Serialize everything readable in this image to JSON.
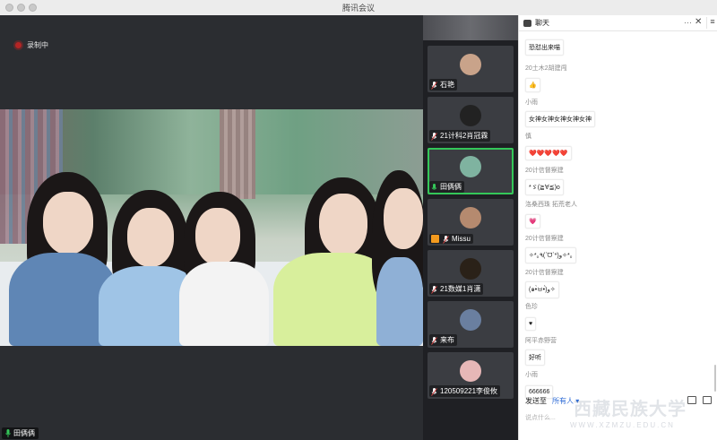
{
  "window": {
    "title": "腾讯会议"
  },
  "recording": {
    "label": "录制中"
  },
  "main_speaker": {
    "name": "田俩俩"
  },
  "participants": [
    {
      "name": "石艳",
      "avatar_color": "#c9a38a"
    },
    {
      "name": "21计科2肖冠霖",
      "avatar_color": "#222222"
    },
    {
      "name": "田俩俩",
      "avatar_color": "#7fb3a0",
      "active": true
    },
    {
      "name": "Missu",
      "avatar_color": "#b58a6f",
      "host": true
    },
    {
      "name": "21数媒1肖潇",
      "avatar_color": "#2a2118"
    },
    {
      "name": "来布",
      "avatar_color": "#6a7fa0"
    },
    {
      "name": "120509221李俊攸",
      "avatar_color": "#e7b7b7"
    }
  ],
  "chat": {
    "title": "聊天",
    "more": "···",
    "close": "✕",
    "menu": "≡",
    "messages": [
      {
        "sender": "",
        "text": "恐怼出来喵"
      },
      {
        "sender": "20土木2胡建闯",
        "text": "👍"
      },
      {
        "sender": "小雨",
        "text": "女神女神女神女神女神"
      },
      {
        "sender": "慎",
        "text": "❤️❤️❤️❤️❤️"
      },
      {
        "sender": "20计信督察建",
        "text": "*ゞ(≧∀≦)o"
      },
      {
        "sender": "洛桑西珠 拓荒老人",
        "text": "💗"
      },
      {
        "sender": "20计信督察建",
        "text": "✧*｡٩(ˊᗜˋ*)و✧*｡"
      },
      {
        "sender": "20计信督察建",
        "text": "(๑•̀ㅂ•́)و✧"
      },
      {
        "sender": "色珍",
        "text": "♥"
      },
      {
        "sender": "阿平赤野营",
        "text": "好听"
      },
      {
        "sender": "小雨",
        "text": "666666"
      }
    ],
    "send_to_label": "发送至",
    "send_to_target": "所有人 ▾",
    "input_placeholder": "说点什么..."
  },
  "watermark": {
    "main": "西藏民族大学",
    "sub": "WWW.XZMZU.EDU.CN"
  },
  "colors": {
    "active_border": "#34c759",
    "recording": "#b42525",
    "link": "#2d6bd6"
  }
}
